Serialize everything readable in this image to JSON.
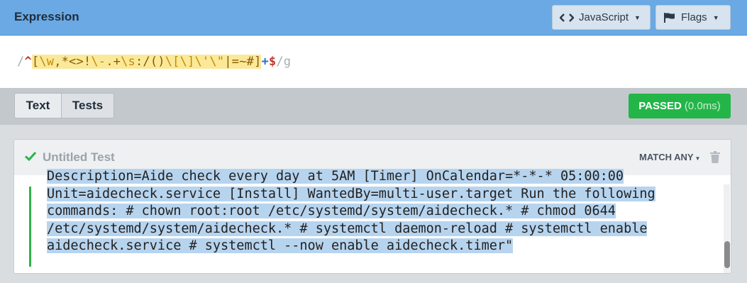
{
  "header": {
    "title": "Expression",
    "language_label": "JavaScript",
    "flags_label": "Flags",
    "background": "#6aa9e4"
  },
  "expression": {
    "open_delim": "/",
    "anchor_start": "^",
    "set_open": "[",
    "esc_w": "\\w",
    "lit1": ",*<>!",
    "esc_dash": "\\-",
    "lit2": ".+",
    "esc_s": "\\s",
    "lit3": ":/()",
    "esc_lb": "\\[",
    "esc_rb": "\\]",
    "esc_q": "\\'",
    "esc_dq": "\\\"",
    "lit4": "|=~#",
    "set_close": "]",
    "quantifier": "+",
    "anchor_end": "$",
    "close_delim": "/",
    "flags": "g"
  },
  "tabs": {
    "text_label": "Text",
    "tests_label": "Tests",
    "active": "Tests"
  },
  "status": {
    "label": "PASSED",
    "duration": "(0.0ms)",
    "color": "#24b548"
  },
  "test": {
    "name": "Untitled Test",
    "match_mode": "MATCH ANY",
    "lines": [
      "Description=Aide check every day at 5AM [Timer] OnCalendar=*-*-* 05:00:00",
      "Unit=aidecheck.service [Install] WantedBy=multi-user.target Run the following",
      "commands: # chown root:root /etc/systemd/system/aidecheck.* # chmod 0644",
      "/etc/systemd/system/aidecheck.* # systemctl daemon-reload # systemctl enable",
      "aidecheck.service # systemctl --now enable aidecheck.timer\""
    ]
  },
  "icons": {
    "language": "code-icon",
    "flags": "flag-icon",
    "check": "check-icon",
    "delete": "trash-icon"
  }
}
